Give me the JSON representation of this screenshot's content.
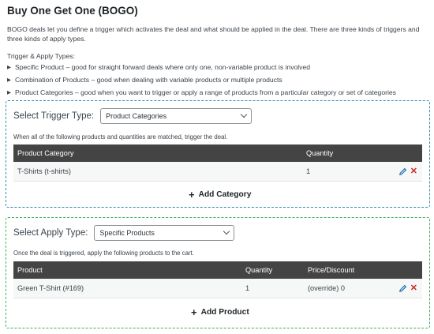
{
  "page": {
    "title": "Buy One Get One (BOGO)",
    "intro": "BOGO deals let you define a trigger which activates the deal and what should be applied in the deal. There are three kinds of triggers and three kinds of apply types.",
    "types_label": "Trigger & Apply Types:",
    "types": [
      "Specific Product – good for straight forward deals where only one, non-variable product is involved",
      "Combination of Products – good when dealing with variable products or multiple products",
      "Product Categories – good when you want to trigger or apply a range of products from a particular category or set of categories"
    ]
  },
  "trigger": {
    "select_label": "Select Trigger Type:",
    "selected": "Product Categories",
    "hint": "When all of the following products and quantities are matched, trigger the deal.",
    "columns": {
      "category": "Product Category",
      "quantity": "Quantity"
    },
    "rows": [
      {
        "category": "T-Shirts (t-shirts)",
        "quantity": "1"
      }
    ],
    "add_label": "Add Category",
    "border_color": "#2e8bb0"
  },
  "apply": {
    "select_label": "Select Apply Type:",
    "selected": "Specific Products",
    "hint": "Once the deal is triggered, apply the following products to the cart.",
    "columns": {
      "product": "Product",
      "quantity": "Quantity",
      "price": "Price/Discount"
    },
    "rows": [
      {
        "product": "Green T-Shirt (#169)",
        "quantity": "1",
        "price": "(override) 0"
      }
    ],
    "add_label": "Add Product",
    "border_color": "#3fae57"
  },
  "icons": {
    "edit": "pencil-icon",
    "delete": "x-icon",
    "add": "plus-icon",
    "bullet": "triangle-right-icon",
    "dropdown": "chevron-down-icon"
  }
}
